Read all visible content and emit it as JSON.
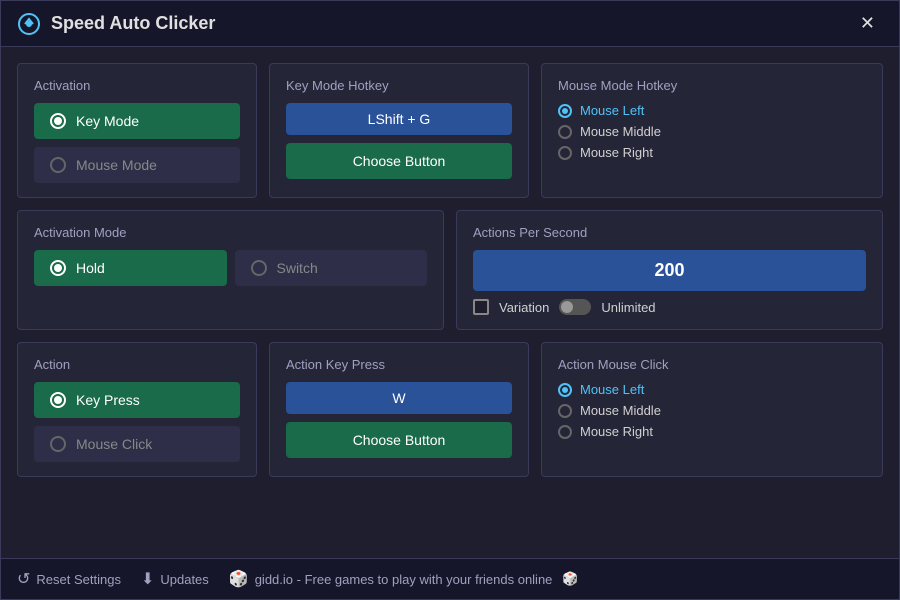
{
  "window": {
    "title": "Speed Auto Clicker",
    "close_label": "✕"
  },
  "activation": {
    "section_title": "Activation",
    "key_mode_label": "Key Mode",
    "mouse_mode_label": "Mouse Mode",
    "key_mode_active": true,
    "mouse_mode_active": false
  },
  "key_mode_hotkey": {
    "label": "Key Mode Hotkey",
    "value": "LShift + G",
    "choose_button_label": "Choose Button"
  },
  "mouse_mode_hotkey": {
    "label": "Mouse Mode Hotkey",
    "mouse_left_label": "Mouse Left",
    "mouse_middle_label": "Mouse Middle",
    "mouse_right_label": "Mouse Right",
    "mouse_left_active": true,
    "mouse_middle_active": false,
    "mouse_right_active": false
  },
  "activation_mode": {
    "section_title": "Activation Mode",
    "hold_label": "Hold",
    "switch_label": "Switch",
    "hold_active": true,
    "switch_active": false
  },
  "actions_per_second": {
    "section_title": "Actions Per Second",
    "value": "200",
    "variation_label": "Variation",
    "unlimited_label": "Unlimited",
    "variation_checked": false
  },
  "action": {
    "section_title": "Action",
    "key_press_label": "Key Press",
    "mouse_click_label": "Mouse Click",
    "key_press_active": true,
    "mouse_click_active": false
  },
  "action_key_press": {
    "label": "Action Key Press",
    "value": "W",
    "choose_button_label": "Choose Button"
  },
  "action_mouse_click": {
    "label": "Action Mouse Click",
    "mouse_left_label": "Mouse Left",
    "mouse_middle_label": "Mouse Middle",
    "mouse_right_label": "Mouse Right",
    "mouse_left_active": true,
    "mouse_middle_active": false,
    "mouse_right_active": false
  },
  "footer": {
    "reset_label": "Reset Settings",
    "updates_label": "Updates",
    "gidd_label": "gidd.io - Free games to play with your friends online"
  }
}
